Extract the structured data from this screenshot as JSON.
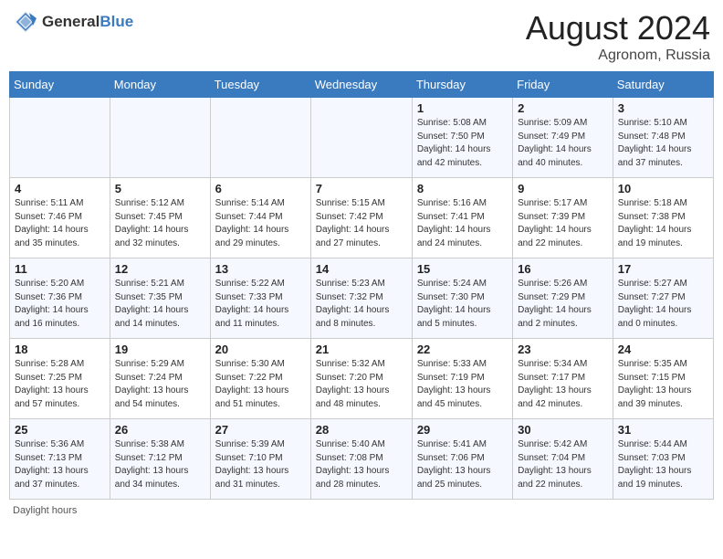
{
  "header": {
    "logo_general": "General",
    "logo_blue": "Blue",
    "month_year": "August 2024",
    "location": "Agronom, Russia"
  },
  "footer": {
    "daylight_label": "Daylight hours"
  },
  "weekdays": [
    "Sunday",
    "Monday",
    "Tuesday",
    "Wednesday",
    "Thursday",
    "Friday",
    "Saturday"
  ],
  "weeks": [
    [
      {
        "day": "",
        "info": ""
      },
      {
        "day": "",
        "info": ""
      },
      {
        "day": "",
        "info": ""
      },
      {
        "day": "",
        "info": ""
      },
      {
        "day": "1",
        "info": "Sunrise: 5:08 AM\nSunset: 7:50 PM\nDaylight: 14 hours\nand 42 minutes."
      },
      {
        "day": "2",
        "info": "Sunrise: 5:09 AM\nSunset: 7:49 PM\nDaylight: 14 hours\nand 40 minutes."
      },
      {
        "day": "3",
        "info": "Sunrise: 5:10 AM\nSunset: 7:48 PM\nDaylight: 14 hours\nand 37 minutes."
      }
    ],
    [
      {
        "day": "4",
        "info": "Sunrise: 5:11 AM\nSunset: 7:46 PM\nDaylight: 14 hours\nand 35 minutes."
      },
      {
        "day": "5",
        "info": "Sunrise: 5:12 AM\nSunset: 7:45 PM\nDaylight: 14 hours\nand 32 minutes."
      },
      {
        "day": "6",
        "info": "Sunrise: 5:14 AM\nSunset: 7:44 PM\nDaylight: 14 hours\nand 29 minutes."
      },
      {
        "day": "7",
        "info": "Sunrise: 5:15 AM\nSunset: 7:42 PM\nDaylight: 14 hours\nand 27 minutes."
      },
      {
        "day": "8",
        "info": "Sunrise: 5:16 AM\nSunset: 7:41 PM\nDaylight: 14 hours\nand 24 minutes."
      },
      {
        "day": "9",
        "info": "Sunrise: 5:17 AM\nSunset: 7:39 PM\nDaylight: 14 hours\nand 22 minutes."
      },
      {
        "day": "10",
        "info": "Sunrise: 5:18 AM\nSunset: 7:38 PM\nDaylight: 14 hours\nand 19 minutes."
      }
    ],
    [
      {
        "day": "11",
        "info": "Sunrise: 5:20 AM\nSunset: 7:36 PM\nDaylight: 14 hours\nand 16 minutes."
      },
      {
        "day": "12",
        "info": "Sunrise: 5:21 AM\nSunset: 7:35 PM\nDaylight: 14 hours\nand 14 minutes."
      },
      {
        "day": "13",
        "info": "Sunrise: 5:22 AM\nSunset: 7:33 PM\nDaylight: 14 hours\nand 11 minutes."
      },
      {
        "day": "14",
        "info": "Sunrise: 5:23 AM\nSunset: 7:32 PM\nDaylight: 14 hours\nand 8 minutes."
      },
      {
        "day": "15",
        "info": "Sunrise: 5:24 AM\nSunset: 7:30 PM\nDaylight: 14 hours\nand 5 minutes."
      },
      {
        "day": "16",
        "info": "Sunrise: 5:26 AM\nSunset: 7:29 PM\nDaylight: 14 hours\nand 2 minutes."
      },
      {
        "day": "17",
        "info": "Sunrise: 5:27 AM\nSunset: 7:27 PM\nDaylight: 14 hours\nand 0 minutes."
      }
    ],
    [
      {
        "day": "18",
        "info": "Sunrise: 5:28 AM\nSunset: 7:25 PM\nDaylight: 13 hours\nand 57 minutes."
      },
      {
        "day": "19",
        "info": "Sunrise: 5:29 AM\nSunset: 7:24 PM\nDaylight: 13 hours\nand 54 minutes."
      },
      {
        "day": "20",
        "info": "Sunrise: 5:30 AM\nSunset: 7:22 PM\nDaylight: 13 hours\nand 51 minutes."
      },
      {
        "day": "21",
        "info": "Sunrise: 5:32 AM\nSunset: 7:20 PM\nDaylight: 13 hours\nand 48 minutes."
      },
      {
        "day": "22",
        "info": "Sunrise: 5:33 AM\nSunset: 7:19 PM\nDaylight: 13 hours\nand 45 minutes."
      },
      {
        "day": "23",
        "info": "Sunrise: 5:34 AM\nSunset: 7:17 PM\nDaylight: 13 hours\nand 42 minutes."
      },
      {
        "day": "24",
        "info": "Sunrise: 5:35 AM\nSunset: 7:15 PM\nDaylight: 13 hours\nand 39 minutes."
      }
    ],
    [
      {
        "day": "25",
        "info": "Sunrise: 5:36 AM\nSunset: 7:13 PM\nDaylight: 13 hours\nand 37 minutes."
      },
      {
        "day": "26",
        "info": "Sunrise: 5:38 AM\nSunset: 7:12 PM\nDaylight: 13 hours\nand 34 minutes."
      },
      {
        "day": "27",
        "info": "Sunrise: 5:39 AM\nSunset: 7:10 PM\nDaylight: 13 hours\nand 31 minutes."
      },
      {
        "day": "28",
        "info": "Sunrise: 5:40 AM\nSunset: 7:08 PM\nDaylight: 13 hours\nand 28 minutes."
      },
      {
        "day": "29",
        "info": "Sunrise: 5:41 AM\nSunset: 7:06 PM\nDaylight: 13 hours\nand 25 minutes."
      },
      {
        "day": "30",
        "info": "Sunrise: 5:42 AM\nSunset: 7:04 PM\nDaylight: 13 hours\nand 22 minutes."
      },
      {
        "day": "31",
        "info": "Sunrise: 5:44 AM\nSunset: 7:03 PM\nDaylight: 13 hours\nand 19 minutes."
      }
    ]
  ]
}
